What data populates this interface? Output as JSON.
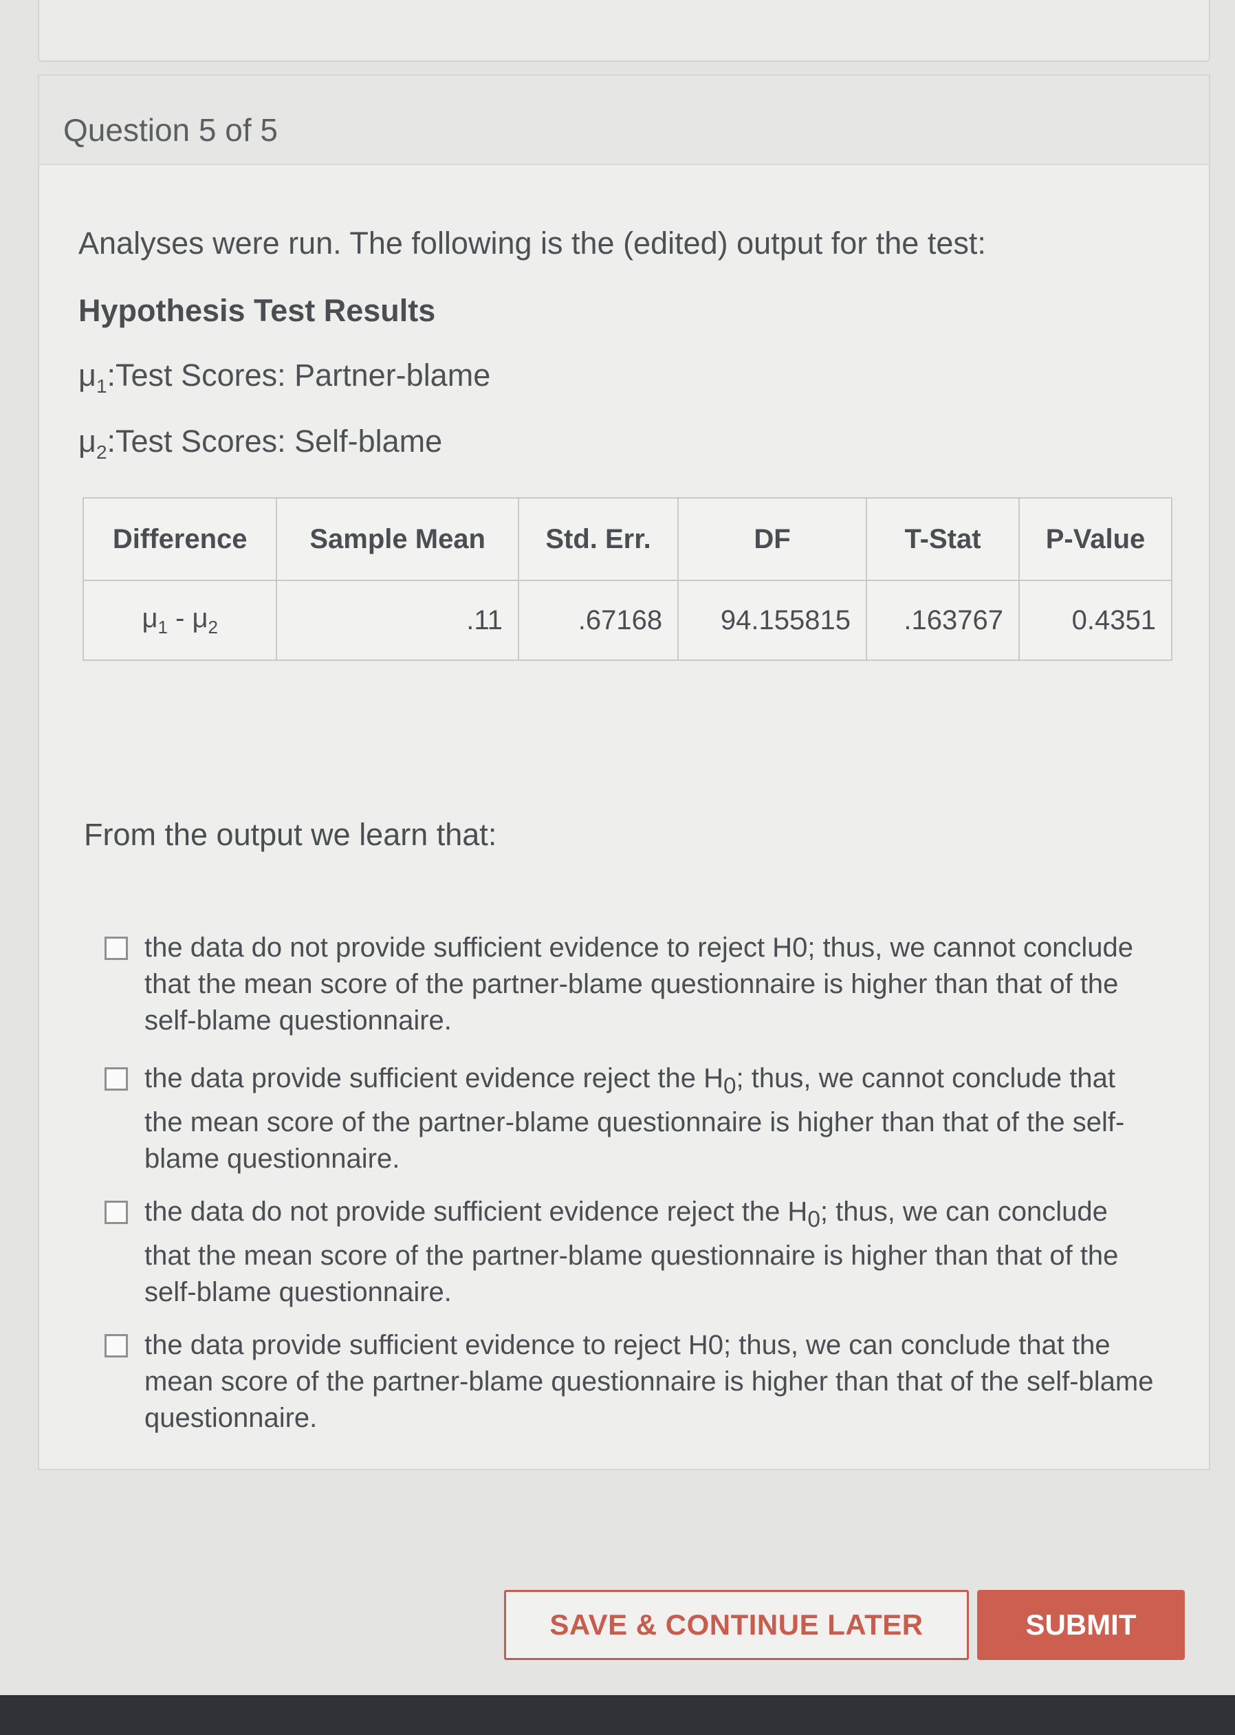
{
  "question": {
    "counter": "Question 5 of 5",
    "intro": "Analyses were run. The following is the (edited) output for the test:",
    "results_title": "Hypothesis Test Results",
    "mu1": {
      "symbol": "μ",
      "sub": "1",
      "label": ":Test Scores: Partner-blame"
    },
    "mu2": {
      "symbol": "μ",
      "sub": "2",
      "label": ":Test Scores: Self-blame"
    }
  },
  "table": {
    "headers": [
      "Difference",
      "Sample Mean",
      "Std. Err.",
      "DF",
      "T-Stat",
      "P-Value"
    ],
    "row": {
      "difference": {
        "a": "μ",
        "a_sub": "1",
        "sep": " - ",
        "b": "μ",
        "b_sub": "2"
      },
      "sample_mean": ".11",
      "std_err": ".67168",
      "df": "94.155815",
      "t_stat": ".163767",
      "p_value": "0.4351"
    }
  },
  "prompt": "From the output we learn that:",
  "options": [
    {
      "text": "the data do not provide sufficient evidence to reject H0; thus, we cannot conclude that the mean score of the partner-blame questionnaire is higher than that of the self-blame questionnaire."
    },
    {
      "pre": "the data provide sufficient evidence reject the H",
      "sub": "0",
      "post": "; thus, we cannot conclude that the mean score of the partner-blame questionnaire is higher than that of the self-blame questionnaire."
    },
    {
      "pre": "the data do not provide sufficient evidence reject the H",
      "sub": "0",
      "post": "; thus, we can conclude that the mean score of the partner-blame questionnaire is higher than that of the self-blame questionnaire."
    },
    {
      "text": "the data provide sufficient evidence to reject H0; thus, we can conclude that the mean score of the partner-blame questionnaire is higher than that of the self-blame questionnaire."
    }
  ],
  "buttons": {
    "save": "SAVE & CONTINUE LATER",
    "submit": "SUBMIT"
  },
  "colors": {
    "accent": "#cc5f50",
    "background": "#e4e5e2"
  }
}
